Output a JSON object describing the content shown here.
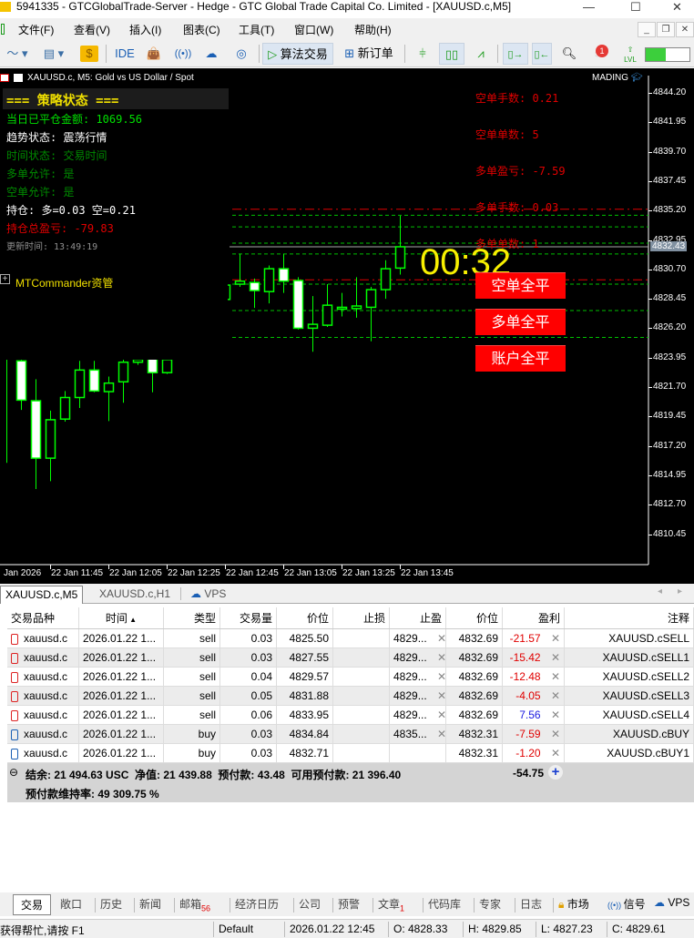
{
  "window": {
    "title": "5941335 - GTCGlobalTrade-Server - Hedge - GTC Global Trade Capital Co. Limited - [XAUUSD.c,M5]"
  },
  "menu": [
    "文件(F)",
    "查看(V)",
    "插入(I)",
    "图表(C)",
    "工具(T)",
    "窗口(W)",
    "帮助(H)"
  ],
  "toolbar": {
    "ide": "IDE",
    "algo_trading": "算法交易",
    "new_order": "新订单",
    "notification_count": "1",
    "lvl": "LVL"
  },
  "chart": {
    "header": "XAUUSD.c, M5:  Gold vs US Dollar / Spot",
    "account_label": "MADING",
    "panel": {
      "title": "=== 策略状态 ===",
      "lines": [
        {
          "text": "当日已平仓金额: 1069.56",
          "color": "#00e000"
        },
        {
          "text": "趋势状态: 震荡行情",
          "color": "#ffffff"
        },
        {
          "text": "时间状态: 交易时间",
          "color": "#008a00"
        },
        {
          "text": "多单允许: 是",
          "color": "#008a00"
        },
        {
          "text": "空单允许: 是",
          "color": "#008a00"
        },
        {
          "text": "持仓: 多=0.03 空=0.21",
          "color": "#ffffff"
        },
        {
          "text": "持仓总盈亏: -79.83",
          "color": "#e00000"
        },
        {
          "text": "更新时间: 13:49:19",
          "color": "#909090"
        }
      ],
      "commander": "MTCommander资管"
    },
    "right_labels": [
      "空单手数: 0.21",
      "空单单数: 5",
      "多单盈亏: -7.59",
      "多单手数: 0.03",
      "多单单数: 1"
    ],
    "countdown": "00:32",
    "buttons": [
      "空单全平",
      "多单全平",
      "账户全平"
    ]
  },
  "chart_data": {
    "type": "candlestick",
    "symbol": "XAUUSD.c",
    "timeframe": "M5",
    "price_ticks": [
      "4844.20",
      "4841.95",
      "4839.70",
      "4837.45",
      "4835.20",
      "4832.95",
      "4830.70",
      "4828.45",
      "4826.20",
      "4823.95",
      "4821.70",
      "4819.45",
      "4817.20",
      "4814.95",
      "4812.70",
      "4810.45"
    ],
    "time_ticks": [
      "Jan 2026",
      "22 Jan 11:45",
      "22 Jan 12:05",
      "22 Jan 12:25",
      "22 Jan 12:45",
      "22 Jan 13:05",
      "22 Jan 13:25",
      "22 Jan 13:45"
    ],
    "current_price": "4832.43",
    "ylim": [
      4808.2,
      4846.5
    ],
    "candles": [
      {
        "t": "11:30",
        "o": 4826.0,
        "h": 4827.0,
        "l": 4815.9,
        "c": 4824.2
      },
      {
        "t": "11:35",
        "o": 4823.7,
        "h": 4824.2,
        "l": 4819.95,
        "c": 4820.7
      },
      {
        "t": "11:40",
        "o": 4820.65,
        "h": 4822.3,
        "l": 4813.9,
        "c": 4816.26
      },
      {
        "t": "11:45",
        "o": 4816.26,
        "h": 4819.9,
        "l": 4814.5,
        "c": 4819.2
      },
      {
        "t": "11:50",
        "o": 4819.25,
        "h": 4821.4,
        "l": 4819.05,
        "c": 4820.9
      },
      {
        "t": "11:55",
        "o": 4820.9,
        "h": 4823.7,
        "l": 4820.1,
        "c": 4823.0
      },
      {
        "t": "12:00",
        "o": 4823.0,
        "h": 4823.7,
        "l": 4821.3,
        "c": 4821.4
      },
      {
        "t": "12:05",
        "o": 4821.35,
        "h": 4822.5,
        "l": 4819.1,
        "c": 4822.0
      },
      {
        "t": "12:10",
        "o": 4822.1,
        "h": 4824.0,
        "l": 4820.5,
        "c": 4823.6
      },
      {
        "t": "12:15",
        "o": 4823.6,
        "h": 4824.1,
        "l": 4823.4,
        "c": 4823.8
      },
      {
        "t": "12:20",
        "o": 4824.2,
        "h": 4824.5,
        "l": 4821.3,
        "c": 4822.8
      },
      {
        "t": "12:25",
        "o": 4822.8,
        "h": 4824.2,
        "l": 4822.7,
        "c": 4823.8
      },
      null,
      null,
      null,
      {
        "t": "12:45",
        "o": 4828.4,
        "h": 4829.6,
        "l": 4828.3,
        "c": 4829.5
      },
      {
        "t": "12:50",
        "o": 4829.57,
        "h": 4831.9,
        "l": 4829.36,
        "c": 4829.8
      },
      {
        "t": "12:55",
        "o": 4829.7,
        "h": 4830.0,
        "l": 4827.75,
        "c": 4829.08
      },
      {
        "t": "13:00",
        "o": 4829.0,
        "h": 4831.0,
        "l": 4828.1,
        "c": 4830.75
      },
      {
        "t": "13:05",
        "o": 4830.75,
        "h": 4831.9,
        "l": 4828.9,
        "c": 4829.8
      },
      {
        "t": "13:10",
        "o": 4829.85,
        "h": 4830.1,
        "l": 4826.1,
        "c": 4826.2
      },
      {
        "t": "13:15",
        "o": 4826.2,
        "h": 4828.66,
        "l": 4824.4,
        "c": 4826.5
      },
      {
        "t": "13:20",
        "o": 4826.43,
        "h": 4829.57,
        "l": 4826.3,
        "c": 4827.96
      },
      {
        "t": "13:25",
        "o": 4827.7,
        "h": 4828.9,
        "l": 4827.1,
        "c": 4827.8
      },
      {
        "t": "13:30",
        "o": 4827.7,
        "h": 4830.1,
        "l": 4827.0,
        "c": 4827.9
      },
      {
        "t": "13:35",
        "o": 4827.8,
        "h": 4829.36,
        "l": 4825.2,
        "c": 4829.15
      },
      {
        "t": "13:40",
        "o": 4829.15,
        "h": 4831.4,
        "l": 4828.45,
        "c": 4830.75
      },
      {
        "t": "13:45",
        "o": 4830.8,
        "h": 4834.8,
        "l": 4830.3,
        "c": 4832.43
      }
    ],
    "order_lines": [
      4834.84,
      4833.95,
      4832.71,
      4831.88,
      4829.57,
      4827.55,
      4825.5
    ],
    "tp_lines": [
      4835.3,
      4829.9
    ],
    "colors": {
      "bg": "#000000",
      "candle": "#00ff00",
      "bear_fill": "#ffffff",
      "order_line": "#00c000",
      "tp_line": "#e00000"
    }
  },
  "tabs": [
    "XAUUSD.c,M5",
    "XAUUSD.c,H1",
    "VPS"
  ],
  "table": {
    "headers": [
      "交易品种",
      "时间",
      "类型",
      "交易量",
      "价位",
      "止损",
      "止盈",
      "价位",
      "盈利",
      "注释"
    ],
    "rows": [
      {
        "symbol": "xauusd.c",
        "time": "2026.01.22 1...",
        "type": "sell",
        "volume": "0.03",
        "price": "4825.50",
        "sl": "",
        "tp": "4829...",
        "cur": "4832.69",
        "profit": "-21.57",
        "comment": "XAUUSD.cSELL"
      },
      {
        "symbol": "xauusd.c",
        "time": "2026.01.22 1...",
        "type": "sell",
        "volume": "0.03",
        "price": "4827.55",
        "sl": "",
        "tp": "4829...",
        "cur": "4832.69",
        "profit": "-15.42",
        "comment": "XAUUSD.cSELL1"
      },
      {
        "symbol": "xauusd.c",
        "time": "2026.01.22 1...",
        "type": "sell",
        "volume": "0.04",
        "price": "4829.57",
        "sl": "",
        "tp": "4829...",
        "cur": "4832.69",
        "profit": "-12.48",
        "comment": "XAUUSD.cSELL2"
      },
      {
        "symbol": "xauusd.c",
        "time": "2026.01.22 1...",
        "type": "sell",
        "volume": "0.05",
        "price": "4831.88",
        "sl": "",
        "tp": "4829...",
        "cur": "4832.69",
        "profit": "-4.05",
        "comment": "XAUUSD.cSELL3"
      },
      {
        "symbol": "xauusd.c",
        "time": "2026.01.22 1...",
        "type": "sell",
        "volume": "0.06",
        "price": "4833.95",
        "sl": "",
        "tp": "4829...",
        "cur": "4832.69",
        "profit": "7.56",
        "comment": "XAUUSD.cSELL4"
      },
      {
        "symbol": "xauusd.c",
        "time": "2026.01.22 1...",
        "type": "buy",
        "volume": "0.03",
        "price": "4834.84",
        "sl": "",
        "tp": "4835...",
        "cur": "4832.31",
        "profit": "-7.59",
        "comment": "XAUUSD.cBUY"
      },
      {
        "symbol": "xauusd.c",
        "time": "2026.01.22 1...",
        "type": "buy",
        "volume": "0.03",
        "price": "4832.71",
        "sl": "",
        "tp": "",
        "cur": "4832.31",
        "profit": "-1.20",
        "comment": "XAUUSD.cBUY1"
      }
    ],
    "summary": {
      "line1": "结余: 21 494.63 USC  净值: 21 439.88  预付款: 43.48  可用预付款: 21 396.40",
      "total": "-54.75",
      "line2": "预付款维持率: 49 309.75 %"
    }
  },
  "bottom_tabs": [
    {
      "label": "交易"
    },
    {
      "label": "敞口"
    },
    {
      "label": "历史"
    },
    {
      "label": "新闻"
    },
    {
      "label": "邮箱",
      "badge": "56"
    },
    {
      "label": "经济日历"
    },
    {
      "label": "公司"
    },
    {
      "label": "预警"
    },
    {
      "label": "文章",
      "badge": "1"
    },
    {
      "label": "代码库"
    },
    {
      "label": "专家"
    },
    {
      "label": "日志"
    },
    {
      "label": "市场"
    },
    {
      "label": "信号"
    },
    {
      "label": "VPS"
    }
  ],
  "status": {
    "help": "获得帮忙,请按 F1",
    "profile": "Default",
    "datetime": "2026.01.22 12:45",
    "open": "O: 4828.33",
    "high": "H: 4829.85",
    "low": "L: 4827.23",
    "close": "C: 4829.61"
  }
}
